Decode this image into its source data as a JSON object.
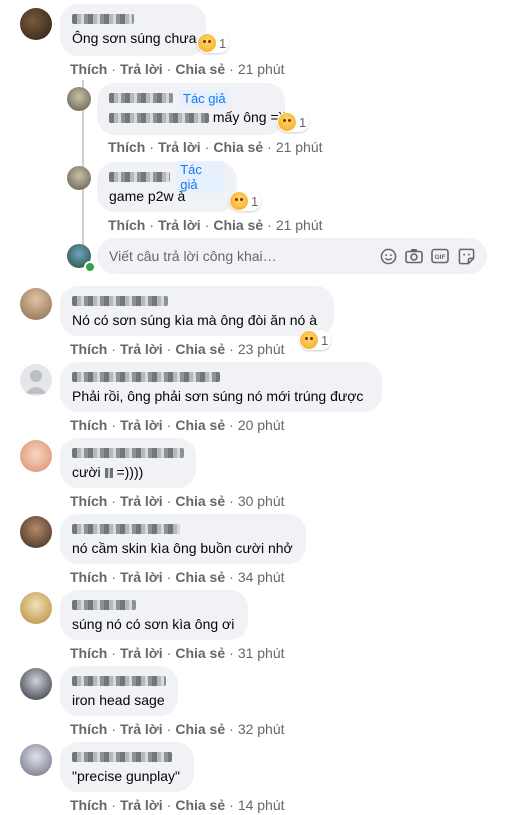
{
  "actions": {
    "like": "Thích",
    "reply": "Trả lời",
    "share": "Chia sẻ",
    "sep": "·"
  },
  "author_badge": "Tác giả",
  "comments": [
    {
      "text": "Ông sơn súng chưa",
      "reaction_count": "1",
      "time": "21 phút"
    },
    {
      "text": "mấy ông =))",
      "reaction_count": "1",
      "time": "21 phút"
    },
    {
      "text": "game p2w à",
      "reaction_count": "1",
      "time": "21 phút"
    },
    {
      "text": "Nó có sơn súng kìa mà ông đòi ăn nó à",
      "reaction_count": "1",
      "time": "23 phút"
    },
    {
      "text": "Phải rồi, ông phải sơn súng nó mới trúng được",
      "time": "20 phút"
    },
    {
      "text_prefix": "cười",
      "text_suffix": "=))))",
      "time": "30 phút"
    },
    {
      "text": "nó cầm skin kìa ông buồn cười nhở",
      "time": "34 phút"
    },
    {
      "text": "súng nó có sơn kìa ông ơi",
      "time": "31 phút"
    },
    {
      "text": "iron head sage",
      "time": "32 phút"
    },
    {
      "text": "\"precise gunplay\"",
      "time": "14 phút"
    }
  ],
  "reply_box": {
    "placeholder": "Viết câu trả lời công khai…",
    "icons": [
      "emoji-icon",
      "camera-icon",
      "gif-icon",
      "sticker-icon"
    ]
  },
  "colors": {
    "accent": "#1877f2",
    "bubble": "#f0f2f5",
    "muted": "#65676b"
  }
}
